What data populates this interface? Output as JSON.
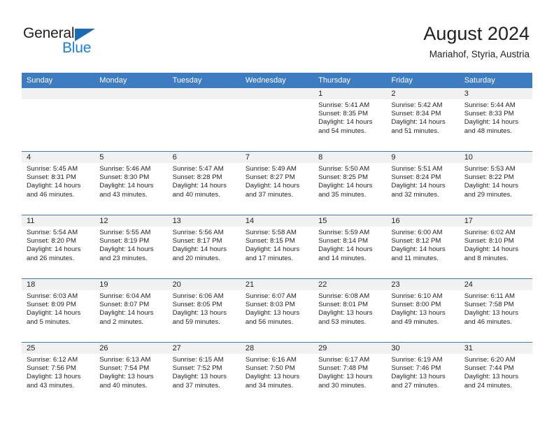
{
  "branding": {
    "name_part1": "General",
    "name_part2": "Blue",
    "triangle_color": "#1b6cb5",
    "blue_text_color": "#1b7fd4"
  },
  "header": {
    "title": "August 2024",
    "subtitle": "Mariahof, Styria, Austria",
    "header_bg_color": "#3d7cc0",
    "daynum_band_color": "#f1f1f1"
  },
  "weekday_headers": [
    "Sunday",
    "Monday",
    "Tuesday",
    "Wednesday",
    "Thursday",
    "Friday",
    "Saturday"
  ],
  "labels": {
    "sunrise_prefix": "Sunrise:",
    "sunset_prefix": "Sunset:",
    "daylight_prefix": "Daylight:"
  },
  "weeks": [
    [
      {
        "day": "",
        "empty": true
      },
      {
        "day": "",
        "empty": true
      },
      {
        "day": "",
        "empty": true
      },
      {
        "day": "",
        "empty": true
      },
      {
        "day": "1",
        "sunrise": "Sunrise: 5:41 AM",
        "sunset": "Sunset: 8:35 PM",
        "daylight": "Daylight: 14 hours and 54 minutes."
      },
      {
        "day": "2",
        "sunrise": "Sunrise: 5:42 AM",
        "sunset": "Sunset: 8:34 PM",
        "daylight": "Daylight: 14 hours and 51 minutes."
      },
      {
        "day": "3",
        "sunrise": "Sunrise: 5:44 AM",
        "sunset": "Sunset: 8:33 PM",
        "daylight": "Daylight: 14 hours and 48 minutes."
      }
    ],
    [
      {
        "day": "4",
        "sunrise": "Sunrise: 5:45 AM",
        "sunset": "Sunset: 8:31 PM",
        "daylight": "Daylight: 14 hours and 46 minutes."
      },
      {
        "day": "5",
        "sunrise": "Sunrise: 5:46 AM",
        "sunset": "Sunset: 8:30 PM",
        "daylight": "Daylight: 14 hours and 43 minutes."
      },
      {
        "day": "6",
        "sunrise": "Sunrise: 5:47 AM",
        "sunset": "Sunset: 8:28 PM",
        "daylight": "Daylight: 14 hours and 40 minutes."
      },
      {
        "day": "7",
        "sunrise": "Sunrise: 5:49 AM",
        "sunset": "Sunset: 8:27 PM",
        "daylight": "Daylight: 14 hours and 37 minutes."
      },
      {
        "day": "8",
        "sunrise": "Sunrise: 5:50 AM",
        "sunset": "Sunset: 8:25 PM",
        "daylight": "Daylight: 14 hours and 35 minutes."
      },
      {
        "day": "9",
        "sunrise": "Sunrise: 5:51 AM",
        "sunset": "Sunset: 8:24 PM",
        "daylight": "Daylight: 14 hours and 32 minutes."
      },
      {
        "day": "10",
        "sunrise": "Sunrise: 5:53 AM",
        "sunset": "Sunset: 8:22 PM",
        "daylight": "Daylight: 14 hours and 29 minutes."
      }
    ],
    [
      {
        "day": "11",
        "sunrise": "Sunrise: 5:54 AM",
        "sunset": "Sunset: 8:20 PM",
        "daylight": "Daylight: 14 hours and 26 minutes."
      },
      {
        "day": "12",
        "sunrise": "Sunrise: 5:55 AM",
        "sunset": "Sunset: 8:19 PM",
        "daylight": "Daylight: 14 hours and 23 minutes."
      },
      {
        "day": "13",
        "sunrise": "Sunrise: 5:56 AM",
        "sunset": "Sunset: 8:17 PM",
        "daylight": "Daylight: 14 hours and 20 minutes."
      },
      {
        "day": "14",
        "sunrise": "Sunrise: 5:58 AM",
        "sunset": "Sunset: 8:15 PM",
        "daylight": "Daylight: 14 hours and 17 minutes."
      },
      {
        "day": "15",
        "sunrise": "Sunrise: 5:59 AM",
        "sunset": "Sunset: 8:14 PM",
        "daylight": "Daylight: 14 hours and 14 minutes."
      },
      {
        "day": "16",
        "sunrise": "Sunrise: 6:00 AM",
        "sunset": "Sunset: 8:12 PM",
        "daylight": "Daylight: 14 hours and 11 minutes."
      },
      {
        "day": "17",
        "sunrise": "Sunrise: 6:02 AM",
        "sunset": "Sunset: 8:10 PM",
        "daylight": "Daylight: 14 hours and 8 minutes."
      }
    ],
    [
      {
        "day": "18",
        "sunrise": "Sunrise: 6:03 AM",
        "sunset": "Sunset: 8:09 PM",
        "daylight": "Daylight: 14 hours and 5 minutes."
      },
      {
        "day": "19",
        "sunrise": "Sunrise: 6:04 AM",
        "sunset": "Sunset: 8:07 PM",
        "daylight": "Daylight: 14 hours and 2 minutes."
      },
      {
        "day": "20",
        "sunrise": "Sunrise: 6:06 AM",
        "sunset": "Sunset: 8:05 PM",
        "daylight": "Daylight: 13 hours and 59 minutes."
      },
      {
        "day": "21",
        "sunrise": "Sunrise: 6:07 AM",
        "sunset": "Sunset: 8:03 PM",
        "daylight": "Daylight: 13 hours and 56 minutes."
      },
      {
        "day": "22",
        "sunrise": "Sunrise: 6:08 AM",
        "sunset": "Sunset: 8:01 PM",
        "daylight": "Daylight: 13 hours and 53 minutes."
      },
      {
        "day": "23",
        "sunrise": "Sunrise: 6:10 AM",
        "sunset": "Sunset: 8:00 PM",
        "daylight": "Daylight: 13 hours and 49 minutes."
      },
      {
        "day": "24",
        "sunrise": "Sunrise: 6:11 AM",
        "sunset": "Sunset: 7:58 PM",
        "daylight": "Daylight: 13 hours and 46 minutes."
      }
    ],
    [
      {
        "day": "25",
        "sunrise": "Sunrise: 6:12 AM",
        "sunset": "Sunset: 7:56 PM",
        "daylight": "Daylight: 13 hours and 43 minutes."
      },
      {
        "day": "26",
        "sunrise": "Sunrise: 6:13 AM",
        "sunset": "Sunset: 7:54 PM",
        "daylight": "Daylight: 13 hours and 40 minutes."
      },
      {
        "day": "27",
        "sunrise": "Sunrise: 6:15 AM",
        "sunset": "Sunset: 7:52 PM",
        "daylight": "Daylight: 13 hours and 37 minutes."
      },
      {
        "day": "28",
        "sunrise": "Sunrise: 6:16 AM",
        "sunset": "Sunset: 7:50 PM",
        "daylight": "Daylight: 13 hours and 34 minutes."
      },
      {
        "day": "29",
        "sunrise": "Sunrise: 6:17 AM",
        "sunset": "Sunset: 7:48 PM",
        "daylight": "Daylight: 13 hours and 30 minutes."
      },
      {
        "day": "30",
        "sunrise": "Sunrise: 6:19 AM",
        "sunset": "Sunset: 7:46 PM",
        "daylight": "Daylight: 13 hours and 27 minutes."
      },
      {
        "day": "31",
        "sunrise": "Sunrise: 6:20 AM",
        "sunset": "Sunset: 7:44 PM",
        "daylight": "Daylight: 13 hours and 24 minutes."
      }
    ]
  ]
}
